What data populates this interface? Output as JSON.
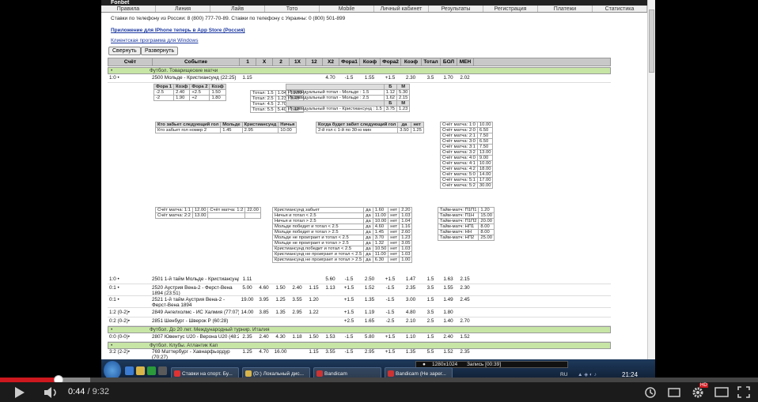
{
  "site": {
    "brand": "Fonbet",
    "menu": [
      "Правила",
      "Линия",
      "Лайв",
      "Тото",
      "Mobile",
      "Личный кабинет",
      "Результаты",
      "Регистрация",
      "Платежи",
      "Статистика"
    ],
    "phones": "Ставки по телефону из России: 8 (800) 777-70-89. Ставки по телефону с Украины: 0 (800) 501-899",
    "iphone_link": "Приложение для IPhone теперь в App Store (Россия)",
    "windows_link": "Клиентская программа для Windows",
    "collapse_btn": "Свернуть",
    "expand_btn": "Развернуть"
  },
  "table": {
    "headers": [
      "Счёт",
      "Событие",
      "1",
      "X",
      "2",
      "1X",
      "12",
      "X2",
      "Фора1",
      "Коэф",
      "Фора2",
      "Коэф",
      "Тотал",
      "БОЛ",
      "МЕН"
    ],
    "groups": [
      {
        "mark": "•",
        "name": "Футбол. Товарищеские матчи"
      },
      {
        "mark": "•",
        "name": "Футбол. До 20 лет. Международный турнир. Италия"
      },
      {
        "mark": "•",
        "name": "Футбол. Клубы. Атлантик Кап"
      }
    ],
    "rows": [
      {
        "score": "1:0 •",
        "event": "2500 Мольде - Кристиансунд (22:25)",
        "c": [
          "1.15",
          "",
          "",
          "",
          "",
          "4.70",
          "-1.5",
          "1.55",
          "+1.5",
          "2.30",
          "3.5",
          "1.70",
          "2.02"
        ]
      },
      {
        "score": "1:0 •",
        "event": "2501 1-й тайм Мольде - Кристиансунд",
        "c": [
          "1.11",
          "",
          "",
          "",
          "",
          "5.60",
          "-1.5",
          "2.50",
          "+1.5",
          "1.47",
          "1.5",
          "1.63",
          "2.15"
        ]
      },
      {
        "score": "0:1 •",
        "event": "2520 Аустрия Вена-2 - Ферст-Вена 1894 (23:51)",
        "c": [
          "5.00",
          "4.60",
          "1.50",
          "2.40",
          "1.15",
          "1.13",
          "+1.5",
          "1.52",
          "-1.5",
          "2.35",
          "3.5",
          "1.55",
          "2.30"
        ]
      },
      {
        "score": "0:1 •",
        "event": "2521 1-й тайм Аустрия Вена-2 - Ферст-Вена 1894",
        "c": [
          "19.00",
          "3.95",
          "1.25",
          "3.55",
          "1.20",
          "",
          "+1.5",
          "1.35",
          "-1.5",
          "3.00",
          "1.5",
          "1.49",
          "2.45"
        ]
      },
      {
        "score": "1:2 (0-2)•",
        "event": "2849 Ангелхолмс - ИС Халмия (77:07)",
        "c": [
          "14.00",
          "3.85",
          "1.35",
          "2.95",
          "1.22",
          "",
          "+1.5",
          "1.19",
          "-1.5",
          "4.80",
          "3.5",
          "1.80",
          ""
        ]
      },
      {
        "score": "0:2 (0-2)•",
        "event": "2851 Шенбург - Шверок Р (60:28)",
        "c": [
          "",
          "",
          "",
          "",
          "",
          "",
          "+2.5",
          "1.65",
          "-2.5",
          "2.10",
          "2.5",
          "1.40",
          "2.70"
        ]
      },
      {
        "score": "0:0 (0-0)•",
        "event": "2807 Ювентус U20 - Верона U20 (48:22)",
        "c": [
          "2.35",
          "2.40",
          "4.30",
          "1.18",
          "1.50",
          "1.53",
          "-1.5",
          "5.80",
          "+1.5",
          "1.10",
          "1.5",
          "2.40",
          "1.52"
        ]
      },
      {
        "score": "3:2 (2-2)•",
        "event": "769 Маттербург - Хавнарфьордур (70:27)",
        "c": [
          "1.25",
          "4.70",
          "16.00",
          "",
          "1.15",
          "3.55",
          "-1.5",
          "2.95",
          "+1.5",
          "1.35",
          "5.5",
          "1.52",
          "2.35"
        ]
      }
    ]
  },
  "sub": {
    "fora": [
      [
        "Фора 1",
        "Коэф",
        "Фора 2",
        "Коэф"
      ],
      [
        "-2.5",
        "2.40",
        "+2.5",
        "1.50"
      ],
      [
        "-2",
        "1.90",
        "+2",
        "1.80"
      ]
    ],
    "totals": [
      [
        "Тотал: 1.5",
        "1.04",
        "10.00"
      ],
      [
        "Тотал: 2.5",
        "1.23",
        "3.70"
      ],
      [
        "Тотал: 4.5",
        "2.70",
        "1.40"
      ],
      [
        "Тотал: 5.5",
        "5.40",
        "1.12"
      ]
    ],
    "indiv": [
      [
        "",
        "Б",
        "М"
      ],
      [
        "Индивидуальный тотал - Мольде : 1.5",
        "1.12",
        "5.30"
      ],
      [
        "Индивидуальный тотал - Мольде : 2.5",
        "1.62",
        "2.15"
      ],
      [
        "",
        "Б",
        "М"
      ],
      [
        "Индивидуальный тотал - Кристиансунд : 1.5",
        "3.75",
        "1.23"
      ]
    ],
    "next": [
      [
        "Кто забьет следующий гол",
        "Мольде",
        "Кристиансунд",
        "Ничья"
      ],
      [
        "Кто забьет гол номер 2",
        "1.45",
        "2.95",
        "10.00"
      ]
    ],
    "when": [
      [
        "Когда будет забит следующий гол",
        "да",
        "нет"
      ],
      [
        "2-й гол с 1-й по 30-ю мин",
        "3.50",
        "1.25"
      ]
    ],
    "scores": [
      [
        "Счёт матча: 1:0",
        "10.00"
      ],
      [
        "Счёт матча: 2:0",
        "6.50"
      ],
      [
        "Счёт матча: 2:1",
        "7.50"
      ],
      [
        "Счёт матча: 3:0",
        "6.50"
      ],
      [
        "Счёт матча: 3:1",
        "7.50"
      ],
      [
        "Счёт матча: 3:2",
        "13.00"
      ],
      [
        "Счёт матча: 4:0",
        "9.00"
      ],
      [
        "Счёт матча: 4:1",
        "10.00"
      ],
      [
        "Счёт матча: 4:2",
        "18.00"
      ],
      [
        "Счёт матча: 5:0",
        "14.00"
      ],
      [
        "Счёт матча: 5:1",
        "17.00"
      ],
      [
        "Счёт матча: 5:2",
        "30.00"
      ]
    ],
    "scores2": [
      [
        "Счёт матча: 1:1",
        "12.00",
        "Счёт матча: 1:2",
        "22.00"
      ],
      [
        "Счёт матча: 2:2",
        "13.00",
        "",
        ""
      ]
    ],
    "specials": [
      [
        "Кристиансунд забьет",
        "да",
        "1.60",
        "нет",
        "2.20"
      ],
      [
        "Ничья и тотал < 2.5",
        "да",
        "11.00",
        "нет",
        "1.03"
      ],
      [
        "Ничья и тотал > 2.5",
        "да",
        "10.00",
        "нет",
        "1.04"
      ],
      [
        "Мольде победит и тотал < 2.5",
        "да",
        "4.60",
        "нет",
        "1.16"
      ],
      [
        "Мольде победит и тотал > 2.5",
        "да",
        "1.45",
        "нет",
        "2.60"
      ],
      [
        "Мольде не проиграет и тотал < 2.5",
        "да",
        "3.70",
        "нет",
        "1.23"
      ],
      [
        "Мольде не проиграет и тотал > 2.5",
        "да",
        "1.32",
        "нет",
        "3.05"
      ],
      [
        "Кристиансунд победит и тотал < 2.5",
        "да",
        "10.50",
        "нет",
        "1.03"
      ],
      [
        "Кристиансунд не проиграет и тотал < 2.5",
        "да",
        "11.00",
        "нет",
        "1.03"
      ],
      [
        "Кристиансунд не проиграет и тотал > 2.5",
        "да",
        "6.30",
        "нет",
        "1.00"
      ]
    ],
    "halftime": [
      [
        "Тайм-матч: П1П1",
        "1.20"
      ],
      [
        "Тайм-матч: П1Н",
        "15.00"
      ],
      [
        "Тайм-матч: П1П2",
        "20.00"
      ],
      [
        "Тайм-матч: НП1",
        "8.00"
      ],
      [
        "Тайм-матч: НН",
        "8.00"
      ],
      [
        "Тайм-матч: НП2",
        "25.00"
      ]
    ]
  },
  "taskbar": {
    "tasks": [
      "Ставки на спорт. Бу...",
      "(D:) Локальный дис...",
      "Bandicam",
      "Bandicam (Не зарег..."
    ],
    "lang": "RU",
    "clock": "21:24",
    "rec_res": "1280x1024",
    "rec_label": "Запись [00:39]"
  },
  "player": {
    "current": "0:44",
    "duration": "9:32",
    "separator": " / ",
    "hd": "HD",
    "played_fraction": 0.077
  }
}
